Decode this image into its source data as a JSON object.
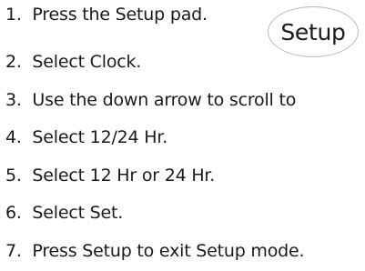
{
  "steps": [
    {
      "number": "1.",
      "text": "Press the Setup pad."
    },
    {
      "number": "2.",
      "text": "Select Clock."
    },
    {
      "number": "3.",
      "text": "Use the down arrow to scroll to"
    },
    {
      "number": "4.",
      "text": "Select 12/24 Hr."
    },
    {
      "number": "5.",
      "text": "Select 12 Hr or 24 Hr."
    },
    {
      "number": "6.",
      "text": "Select Set."
    },
    {
      "number": "7.",
      "text": "Press Setup to exit Setup mode."
    }
  ],
  "setup_pad": {
    "label": "Setup"
  }
}
